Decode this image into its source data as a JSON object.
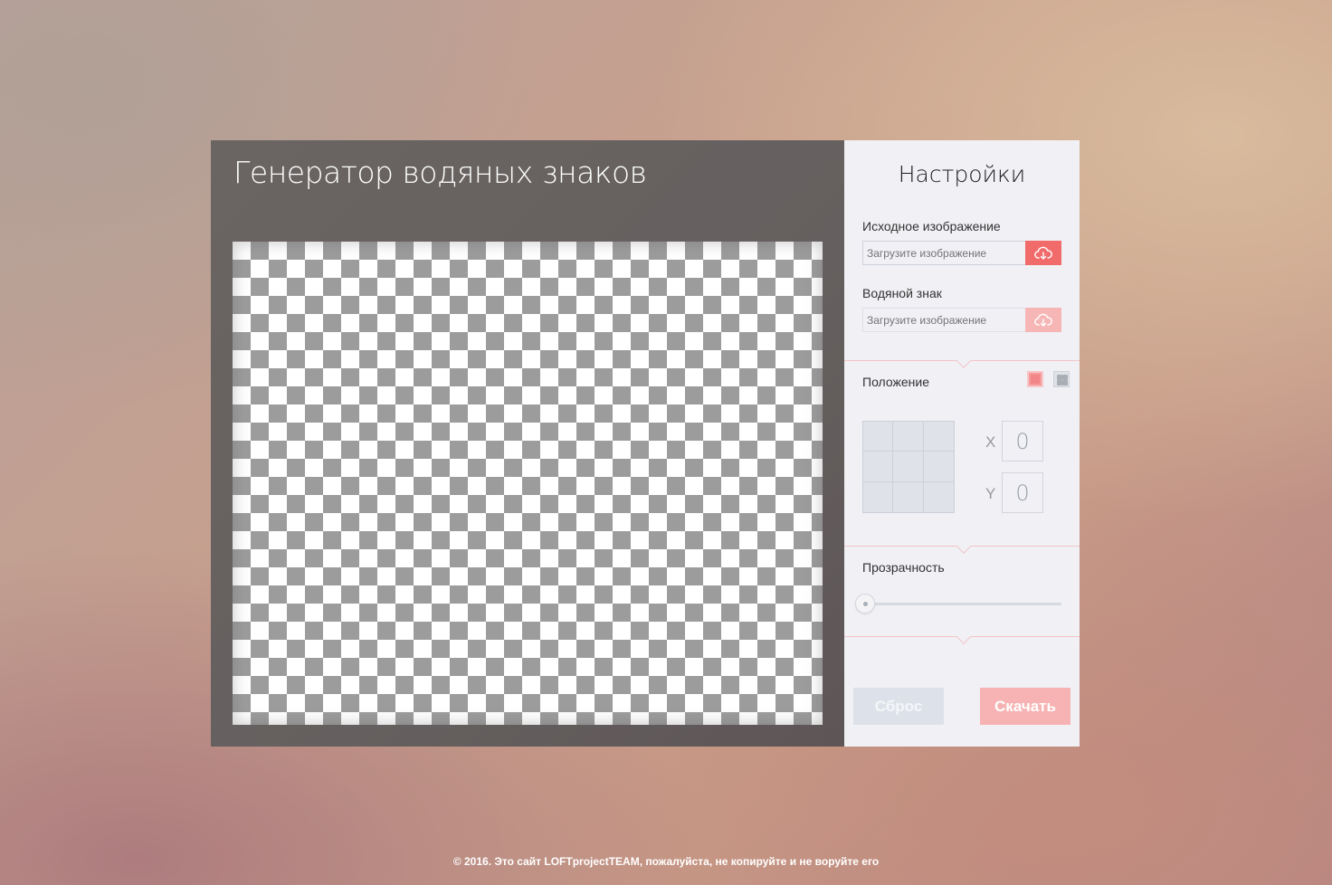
{
  "app": {
    "title": "Генератор водяных знаков"
  },
  "settings": {
    "title": "Настройки",
    "source_image": {
      "label": "Исходное изображение",
      "placeholder": "Загрузите изображение",
      "upload_icon": "cloud-download-icon"
    },
    "watermark": {
      "label": "Водяной знак",
      "placeholder": "Загрузите изображение",
      "upload_icon": "cloud-download-icon"
    },
    "position": {
      "label": "Положение",
      "modes": [
        "single-icon",
        "tile-icon"
      ],
      "x_label": "X",
      "x_value": "0",
      "y_label": "Y",
      "y_value": "0"
    },
    "opacity": {
      "label": "Прозрачность",
      "value": 0
    },
    "buttons": {
      "reset": "Сброс",
      "download": "Скачать"
    }
  },
  "colors": {
    "accent": "#f26b6b",
    "accent_disabled": "#f7b3b3",
    "stage": "#65605f",
    "panel": "#f0f0f5"
  },
  "footer": {
    "text": "© 2016. Это сайт LOFTprojectTEAM, пожалуйста, не копируйте и не воруйте его"
  }
}
